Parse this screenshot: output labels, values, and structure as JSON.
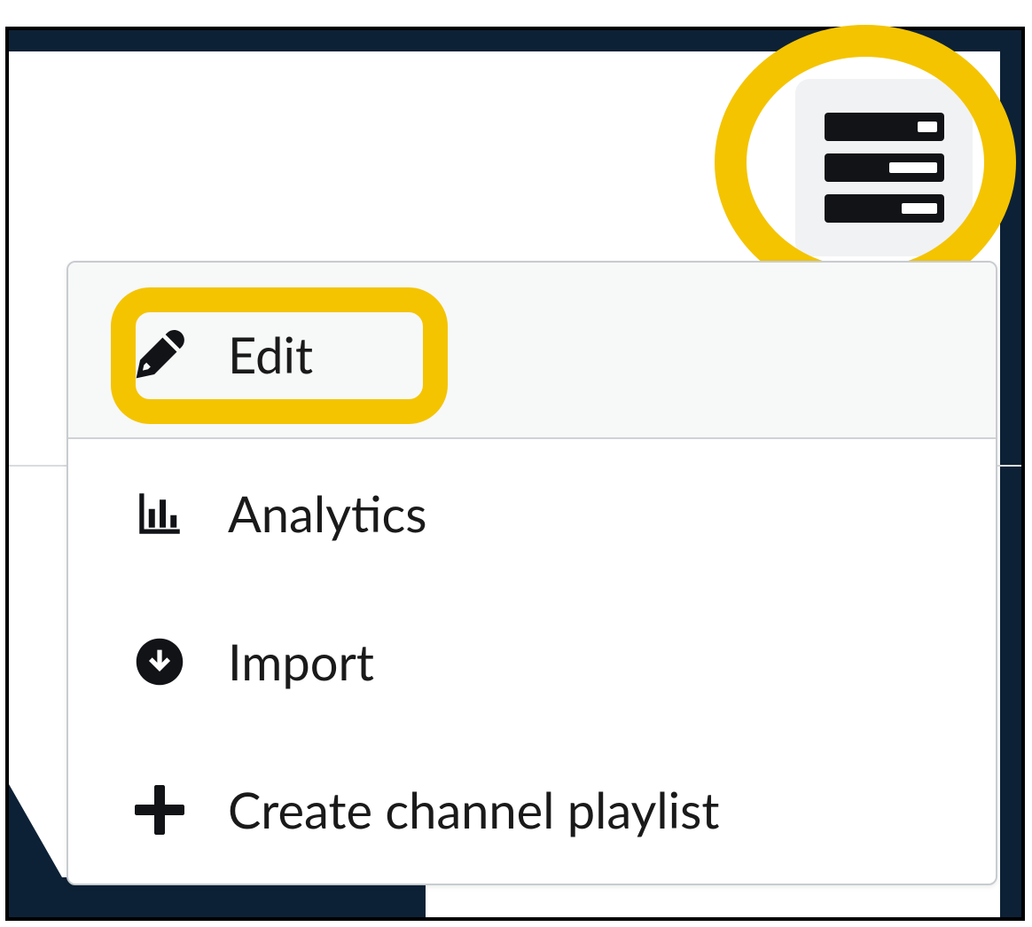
{
  "menu_button": {
    "name": "channel-actions-menu-button",
    "icon": "menu-list-icon"
  },
  "dropdown": {
    "items": [
      {
        "icon": "wrench-icon",
        "label": "Edit",
        "highlighted": true
      },
      {
        "icon": "bar-chart-icon",
        "label": "Analytics",
        "highlighted": false
      },
      {
        "icon": "download-circle-icon",
        "label": "Import",
        "highlighted": false
      },
      {
        "icon": "plus-icon",
        "label": "Create channel playlist",
        "highlighted": false
      }
    ]
  },
  "highlights": {
    "menu_button_circled": true,
    "edit_item_boxed": true,
    "highlight_color": "#f4c400"
  }
}
